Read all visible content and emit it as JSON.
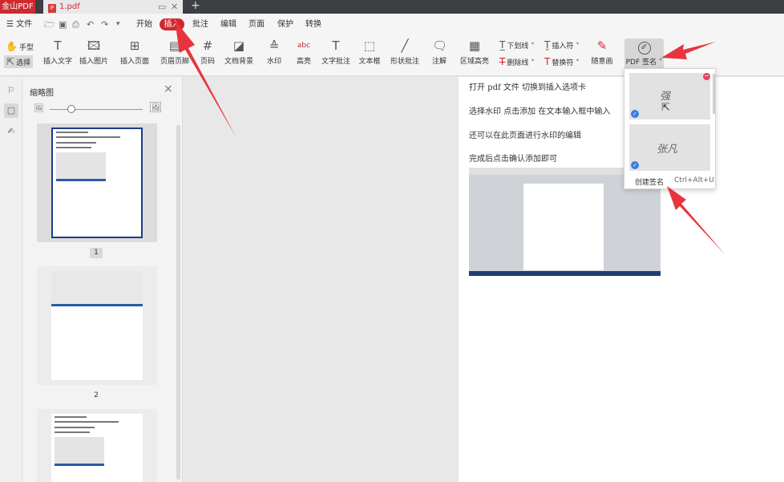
{
  "app": {
    "name": "金山PDF",
    "tab_title": "1.pdf",
    "new_tab": "+"
  },
  "menu": {
    "file": "☰ 文件",
    "tabs": [
      "开始",
      "插入",
      "批注",
      "编辑",
      "页面",
      "保护",
      "转换"
    ],
    "active_tab": "插入"
  },
  "ribbon": {
    "hand": "手型",
    "select": "选择",
    "insert_text": "插入文字",
    "insert_image": "插入图片",
    "insert_page": "插入页面",
    "header_footer": "页眉页脚",
    "page_number": "页码",
    "doc_background": "文档背景",
    "watermark": "水印",
    "highlight": "高亮",
    "text_annotation": "文字批注",
    "text_box": "文本框",
    "shape_annotation": "形状批注",
    "note": "注解",
    "area_highlight": "区域高亮",
    "underline": "下划线",
    "strikethrough": "删除线",
    "insert_mark": "插入符",
    "replace_mark": "替换符",
    "freehand": "随意画",
    "pdf_signature": "PDF 签名"
  },
  "thumbnails": {
    "title": "缩略图",
    "pages": [
      {
        "label": "1"
      },
      {
        "label": "2"
      }
    ]
  },
  "document": {
    "lines": [
      "打开 pdf 文件    切换到插入选项卡",
      "选择水印     点击添加    在文本输入框中输入",
      "还可以在此页面进行水印的编辑",
      "完成后点击确认添加即可"
    ]
  },
  "signature_menu": {
    "create": "创建签名",
    "shortcut": "Ctrl+Alt+U",
    "sig1_text": "强",
    "sig2_text": "张凡"
  },
  "colors": {
    "brand": "#cf2a31",
    "arrow": "#e8343d",
    "titlebar": "#3d3f45"
  }
}
